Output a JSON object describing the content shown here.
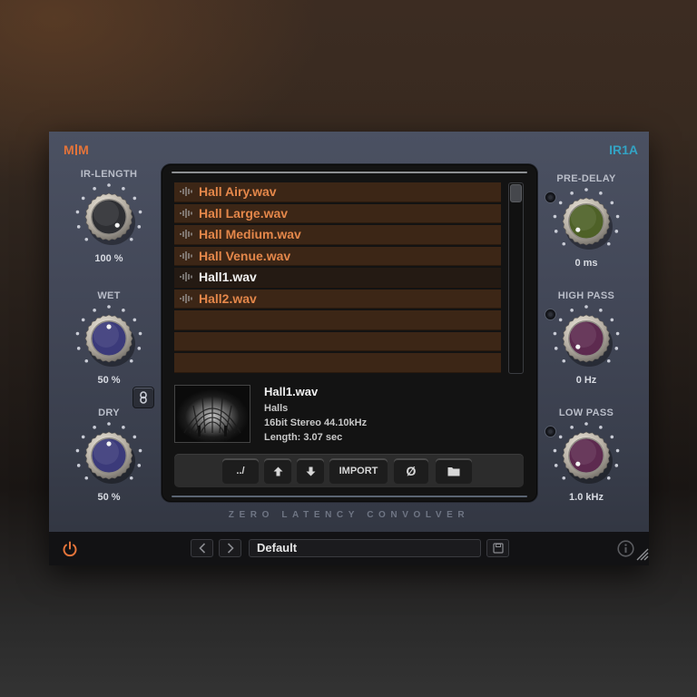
{
  "brand": {
    "logo": "M|M",
    "logo_left": "M",
    "logo_right": "M",
    "product": "IR1A",
    "accent": "#e4743a",
    "product_color": "#33a3c4"
  },
  "left_knobs": [
    {
      "label": "IR-LENGTH",
      "value": "100 %",
      "fraction": 1.0,
      "cap_color": "#2e2f33"
    },
    {
      "label": "WET",
      "value": "50 %",
      "fraction": 0.5,
      "cap_color": "#3b3a7a"
    },
    {
      "label": "DRY",
      "value": "50 %",
      "fraction": 0.5,
      "cap_color": "#3b3a7a"
    }
  ],
  "right_knobs": [
    {
      "label": "PRE-DELAY",
      "value": "0 ms",
      "fraction": 0.0,
      "cap_color": "#4e6127"
    },
    {
      "label": "HIGH PASS",
      "value": "0 Hz",
      "fraction": 0.0,
      "cap_color": "#5d2a4f"
    },
    {
      "label": "LOW PASS",
      "value": "1.0 kHz",
      "fraction": 0.0,
      "cap_color": "#5d2a4f"
    }
  ],
  "link_button": {
    "icon": "link-icon"
  },
  "file_browser": {
    "files": [
      {
        "name": "Hall Airy.wav",
        "selected": false
      },
      {
        "name": "Hall Large.wav",
        "selected": false
      },
      {
        "name": "Hall Medium.wav",
        "selected": false
      },
      {
        "name": "Hall Venue.wav",
        "selected": false
      },
      {
        "name": "Hall1.wav",
        "selected": true
      },
      {
        "name": "Hall2.wav",
        "selected": false
      },
      {
        "name": "",
        "selected": false
      },
      {
        "name": "",
        "selected": false
      },
      {
        "name": "",
        "selected": false
      }
    ],
    "selected_info": {
      "name": "Hall1.wav",
      "category": "Halls",
      "format": "16bit Stereo 44.10kHz",
      "length": "Length: 3.07 sec"
    },
    "toolbar": {
      "parent": "../",
      "up_icon": "arrow-up-icon",
      "down_icon": "arrow-down-icon",
      "import": "IMPORT",
      "clear": "Ø",
      "folder_icon": "folder-icon"
    }
  },
  "subtitle": "ZERO LATENCY CONVOLVER",
  "footer": {
    "power_icon": "power-icon",
    "prev_icon": "chevron-left-icon",
    "next_icon": "chevron-right-icon",
    "preset_name": "Default",
    "save_icon": "save-icon",
    "info_icon": "info-icon"
  }
}
